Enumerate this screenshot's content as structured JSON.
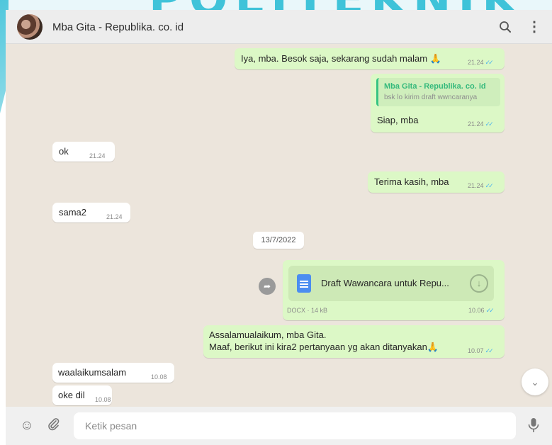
{
  "header": {
    "contact_name": "Mba Gita - Republika. co. id",
    "search_icon": "search-icon",
    "menu_icon": "more-vertical-icon",
    "menu_glyph": "⋮"
  },
  "messages": [
    {
      "direction": "out",
      "text": "Iya, mba. Besok saja, sekarang sudah malam 🙏",
      "time": "21.24",
      "status": "read"
    },
    {
      "direction": "out",
      "quote": {
        "author": "Mba Gita - Republika. co. id",
        "text": "bsk lo kirim draft wwncaranya"
      },
      "text": "Siap, mba",
      "time": "21.24",
      "status": "read"
    },
    {
      "direction": "in",
      "text": "ok",
      "time": "21.24"
    },
    {
      "direction": "out",
      "text": "Terima kasih, mba",
      "time": "21.24",
      "status": "read"
    },
    {
      "direction": "in",
      "text": "sama2",
      "time": "21.24"
    },
    {
      "type": "date",
      "text": "13/7/2022"
    },
    {
      "direction": "out",
      "type": "document",
      "file_name": "Draft Wawancara untuk Repu...",
      "file_meta": "DOCX · 14 kB",
      "time": "10.06",
      "status": "read"
    },
    {
      "direction": "out",
      "text_line1": "Assalamualaikum, mba Gita.",
      "text_line2": "Maaf, berikut ini kira2 pertanyaan yg akan ditanyakan🙏",
      "time": "10.07",
      "status": "read"
    },
    {
      "direction": "in",
      "text": "waalaikumsalam",
      "time": "10.08"
    },
    {
      "direction": "in",
      "text": "oke dil",
      "time": "10.08"
    }
  ],
  "ticks_glyph": "✓✓",
  "scroll_down_glyph": "⌄",
  "forward_glyph": "➦",
  "download_glyph": "↓",
  "composer": {
    "placeholder": "Ketik pesan",
    "value": "",
    "emoji_glyph": "☺",
    "attach_glyph": "🖇",
    "mic_glyph": "🎙"
  },
  "watermark": "POLITEKNIK",
  "colors": {
    "outgoing_bubble": "#dcf8c6",
    "incoming_bubble": "#ffffff",
    "read_ticks": "#4fb6ec",
    "quote_accent": "#35c482",
    "chat_background": "#ece5dc"
  }
}
